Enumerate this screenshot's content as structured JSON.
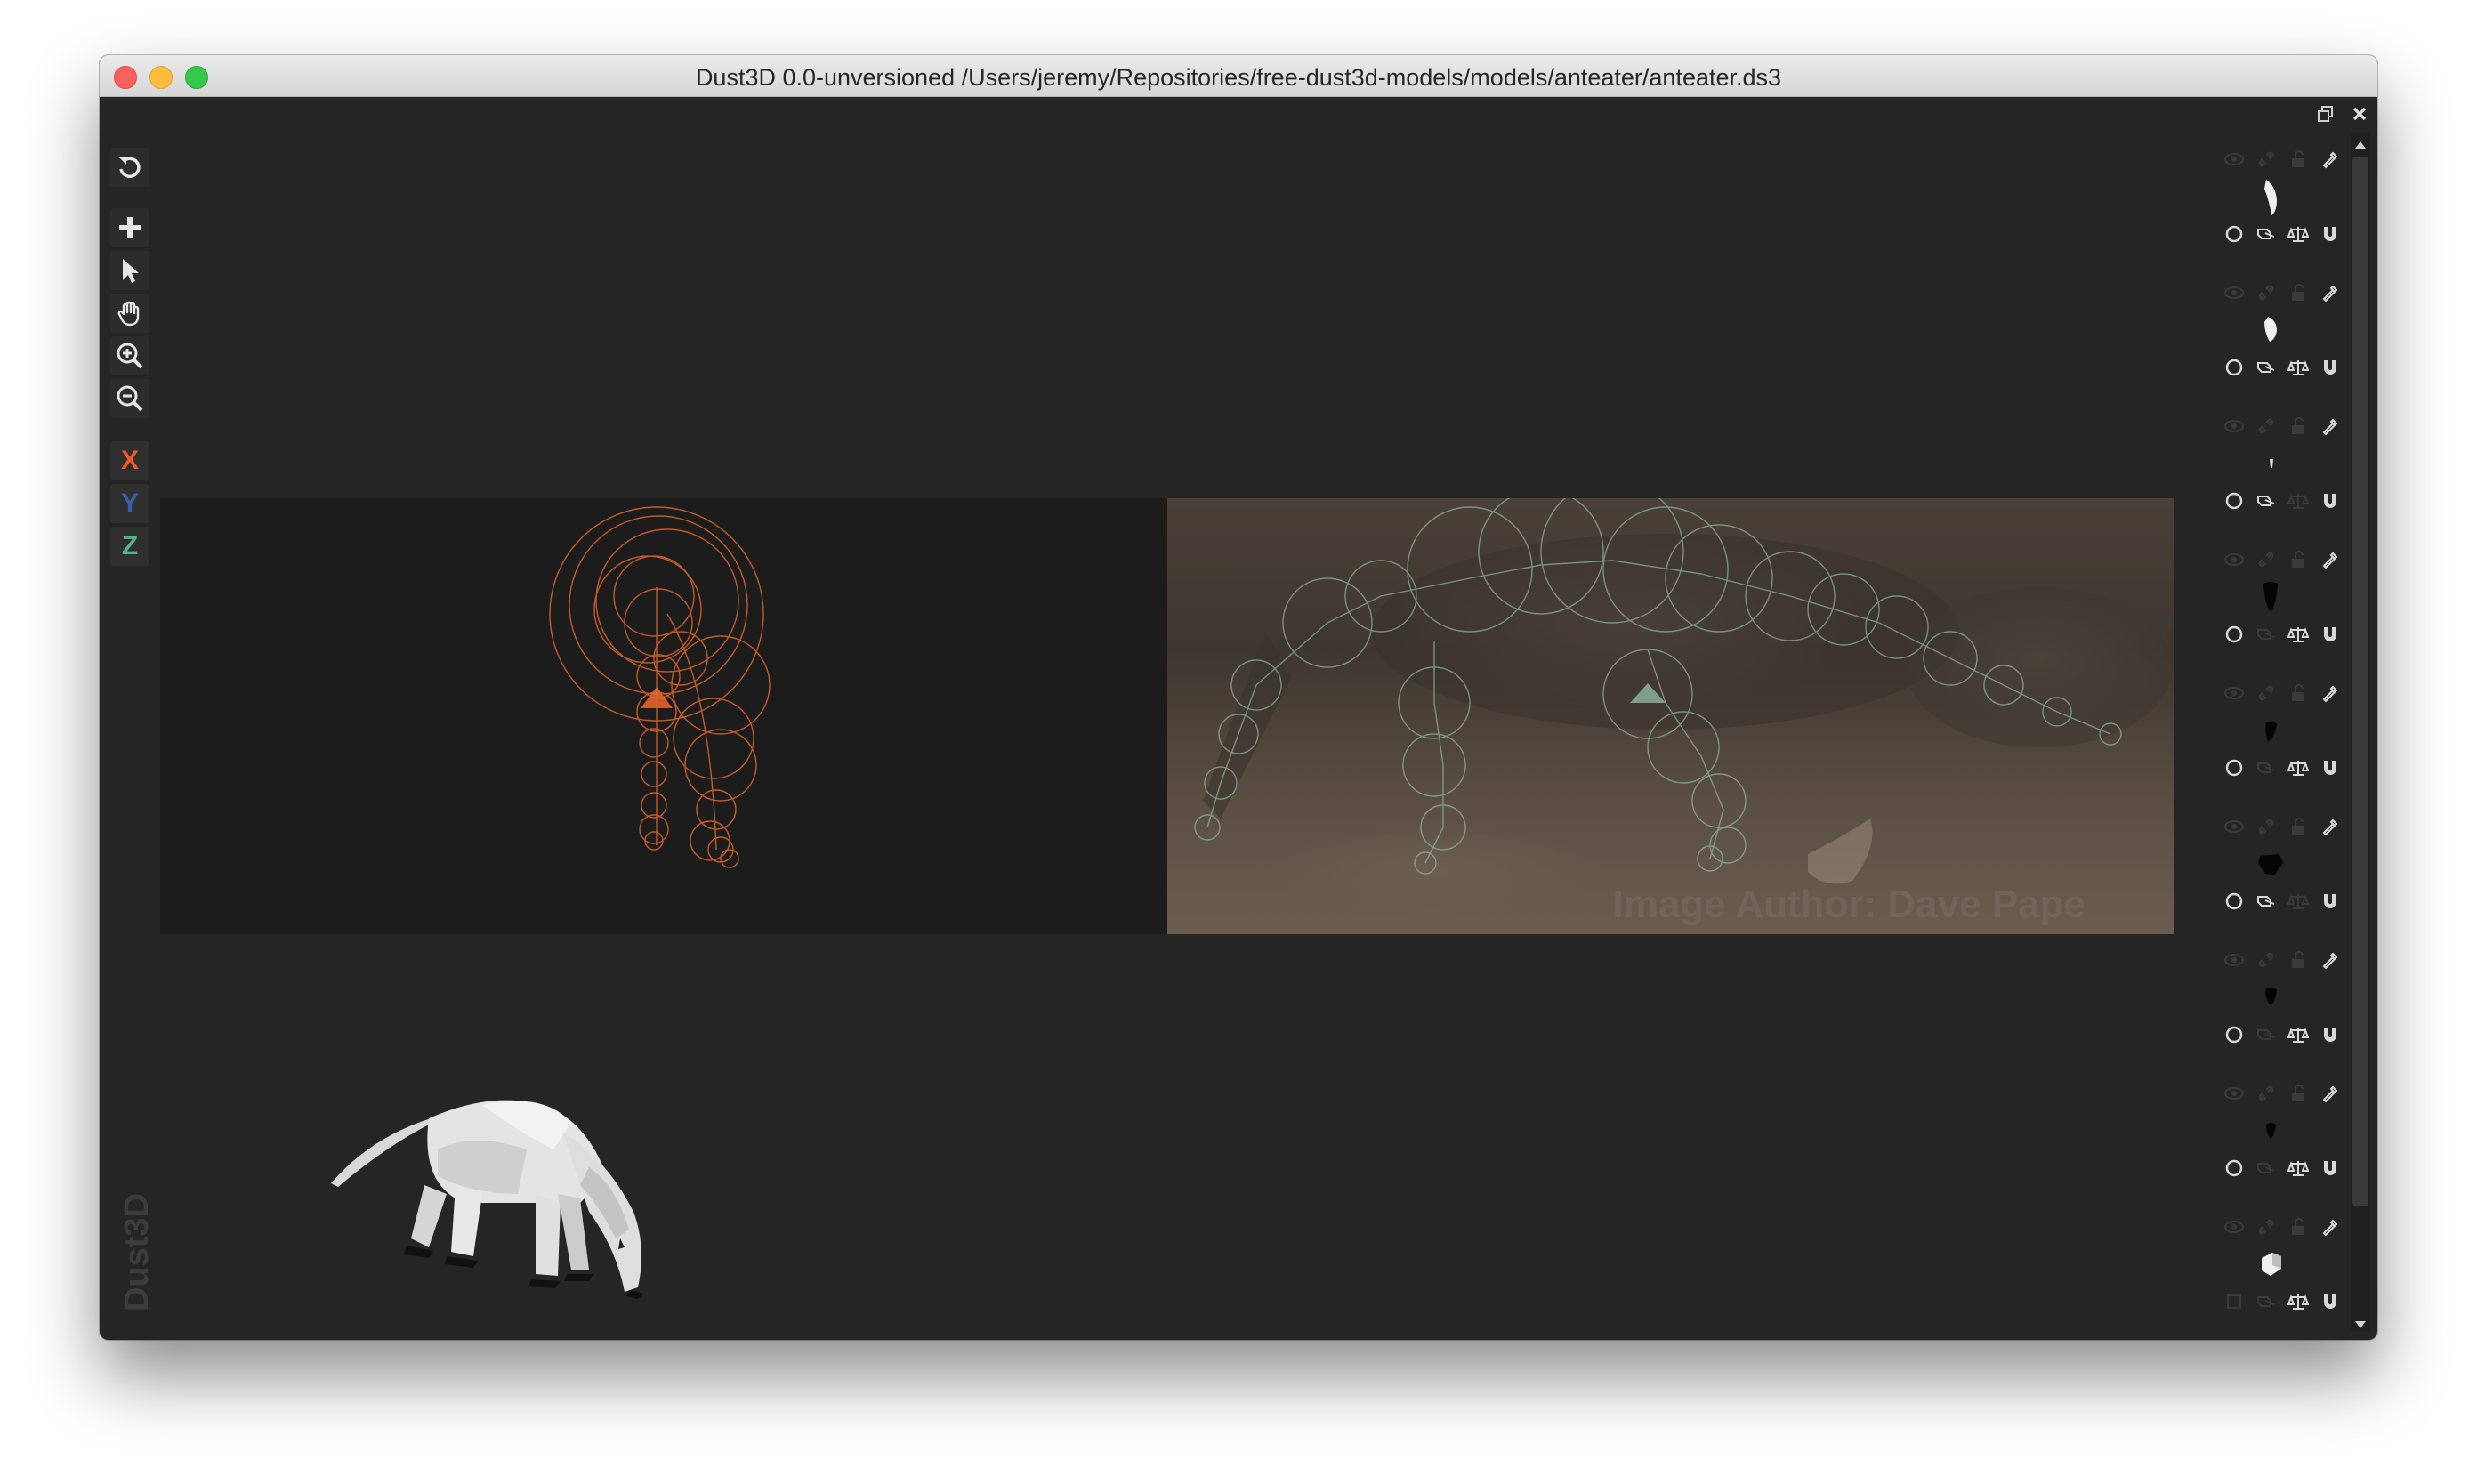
{
  "window": {
    "title": "Dust3D 0.0-unversioned /Users/jeremy/Repositories/free-dust3d-models/models/anteater/anteater.ds3"
  },
  "toolbar": {
    "tools": [
      {
        "name": "undo-icon"
      },
      {
        "name": "add-icon"
      },
      {
        "name": "select-icon"
      },
      {
        "name": "hand-icon"
      },
      {
        "name": "zoom-in-icon"
      },
      {
        "name": "zoom-out-icon"
      }
    ],
    "axes": [
      {
        "label": "X",
        "color": "#f05a28"
      },
      {
        "label": "Y",
        "color": "#3a5fa8"
      },
      {
        "label": "Z",
        "color": "#56b488"
      }
    ]
  },
  "reference_image": {
    "watermark": "Image Author: Dave Pape"
  },
  "brand": "Dust3D",
  "colors": {
    "front_nodes": "#e0652c",
    "side_nodes": "#8fb8a0",
    "background": "#252525"
  },
  "parts": [
    {
      "thumb": "white-limb",
      "vis": true
    },
    {
      "thumb": "white-limb",
      "vis": true
    },
    {
      "thumb": "tiny-dot",
      "vis": true
    },
    {
      "thumb": "black-shape",
      "vis": true
    },
    {
      "thumb": "black-shape",
      "vis": true
    },
    {
      "thumb": "black-shape",
      "vis": true
    },
    {
      "thumb": "black-shape",
      "vis": true
    },
    {
      "thumb": "black-shape",
      "vis": true
    },
    {
      "thumb": "white-block",
      "vis": true
    }
  ]
}
